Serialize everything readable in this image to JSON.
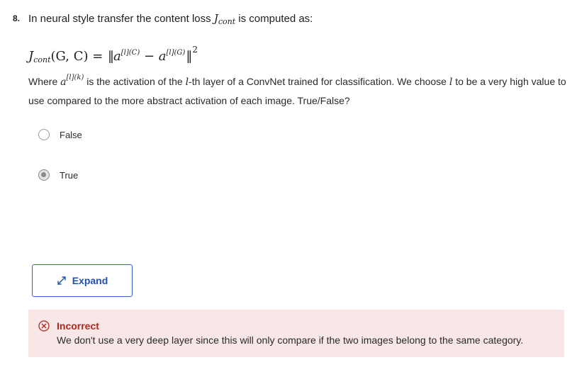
{
  "question": {
    "number": "8.",
    "intro": "In neural style transfer the content loss ",
    "intro_suffix": " is computed as:",
    "j_symbol": "J",
    "j_sub": "cont",
    "formula_args": "(G, C) = ",
    "formula_a1": "a",
    "formula_sup1": "[l](C)",
    "formula_minus": " − ",
    "formula_a2": "a",
    "formula_sup2": "[l](G)",
    "formula_exp": "2",
    "body_where": "Where ",
    "body_a": "a",
    "body_a_sup": "[l](k)",
    "body_mid1": " is the activation of the ",
    "body_l": "l",
    "body_mid2": "-th layer of a ConvNet trained for classification. We choose ",
    "body_l2": "l",
    "body_end": " to be a very high value to use compared to the more abstract activation of each image. True/False?"
  },
  "options": [
    {
      "label": "False",
      "selected": false
    },
    {
      "label": "True",
      "selected": true
    }
  ],
  "expand_button": {
    "label": "Expand",
    "icon": "expand-arrows-icon"
  },
  "feedback": {
    "status": "Incorrect",
    "message": "We don't use a very deep layer since this will only compare if the two images belong to the same category.",
    "icon": "x-circle-icon",
    "color": "#b3261e"
  },
  "colors": {
    "accent": "#2f63c9",
    "error_bg": "#f9e6e6",
    "error": "#b3261e"
  }
}
